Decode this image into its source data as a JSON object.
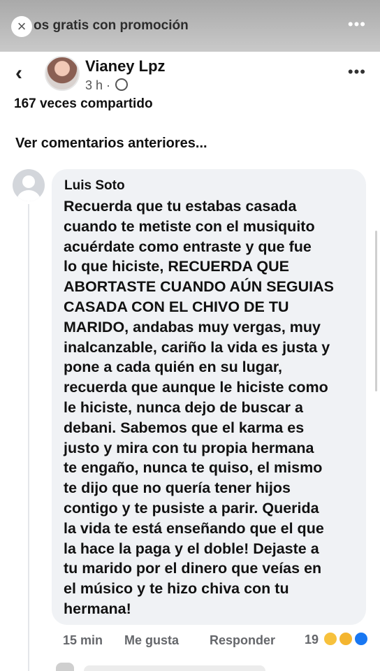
{
  "promo": {
    "text": "os gratis con promoción",
    "close_icon": "close-icon",
    "more_icon": "more-icon"
  },
  "header": {
    "back_icon": "chevron-left-icon",
    "author": "Vianey Lpz",
    "time": "3 h ·",
    "privacy_icon": "globe-icon"
  },
  "post": {
    "shares": "167 veces compartido"
  },
  "comments": {
    "view_previous": "Ver comentarios anteriores...",
    "items": [
      {
        "name": "Luis Soto",
        "lines": [
          "Recuerda que tu estabas casada",
          "cuando te metiste con el musiquito",
          "acuérdate como entraste y que fue",
          "lo que hiciste, RECUERDA QUE",
          "ABORTASTE CUANDO AÚN SEGUIAS",
          "CASADA CON EL CHIVO DE TU",
          "MARIDO, andabas muy vergas, muy",
          "inalcanzable, cariño la vida es justa y",
          "pone a cada quién en su lugar,",
          "recuerda que aunque le hiciste como",
          "le hiciste, nunca dejo de buscar a",
          "debani. Sabemos que el karma es",
          "justo y mira con tu propia hermana",
          "te engaño, nunca te quiso, el mismo",
          "te dijo que no quería tener hijos",
          "contigo y te pusiste a parir. Querida",
          "la vida te está enseñando que el que",
          "la hace la paga y el doble!  Dejaste a",
          "tu marido por el dinero que veías en",
          "el músico y te hizo chiva con tu",
          "hermana!"
        ],
        "time": "15 min",
        "like_label": "Me gusta",
        "reply_label": "Responder",
        "reaction_count": "19",
        "reaction_icons": [
          "wow-icon",
          "haha-icon",
          "like-icon"
        ]
      }
    ]
  }
}
